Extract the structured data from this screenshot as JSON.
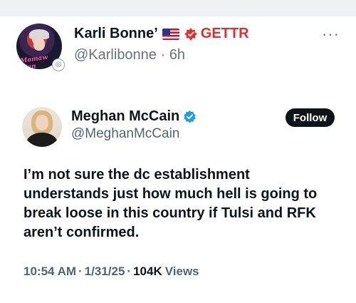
{
  "post": {
    "author_name": "Karli Bonne’",
    "platform_label": "GETTR",
    "handle": "@Karlibonne",
    "separator": "·",
    "age": "6h",
    "avatar_caption": "Mamaw Hen",
    "more_label": "···"
  },
  "embedded_tweet": {
    "author_name": "Meghan McCain",
    "handle": "@MeghanMcCain",
    "follow_label": "Follow",
    "text": "I’m not sure the dc establishment understands just how much hell is going to break loose in this country if Tulsi and RFK aren’t confirmed.",
    "time": "10:54 AM",
    "dot": "·",
    "date": "1/31/25",
    "views_count": "104K",
    "views_label": "Views"
  },
  "colors": {
    "gettr_red": "#e12d2d",
    "verified_blue": "#1d9bf0",
    "follow_bg": "#0f1419",
    "muted_text": "#536471"
  },
  "icons": [
    "us-flag-icon",
    "gettr-logo-icon",
    "verified-badge-icon",
    "more-options-icon"
  ]
}
